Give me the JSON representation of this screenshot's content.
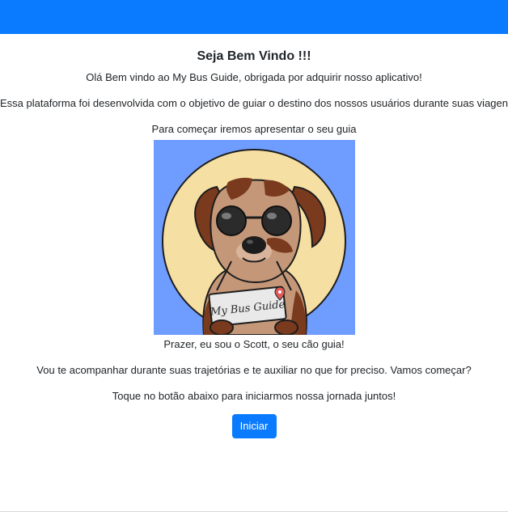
{
  "header": {
    "accent_color": "#0a7bff"
  },
  "welcome": {
    "title": "Seja Bem Vindo !!!",
    "line1": "Olá Bem vindo ao My Bus Guide, obrigada por adquirir nosso aplicativo!",
    "line2": "Essa plataforma foi desenvolvida com o objetivo de guiar o destino dos nossos usuários durante suas viagens.",
    "line3": "Para começar iremos apresentar o seu guia"
  },
  "guide": {
    "sign_text": "My Bus Guide",
    "caption": "Prazer, eu sou o Scott, o seu cão guia!",
    "line5": "Vou te acompanhar durante suas trajetórias e te auxiliar no que for preciso. Vamos começar?",
    "line6": "Toque no botão abaixo para iniciarmos nossa jornada juntos!"
  },
  "actions": {
    "start_label": "Iniciar"
  }
}
